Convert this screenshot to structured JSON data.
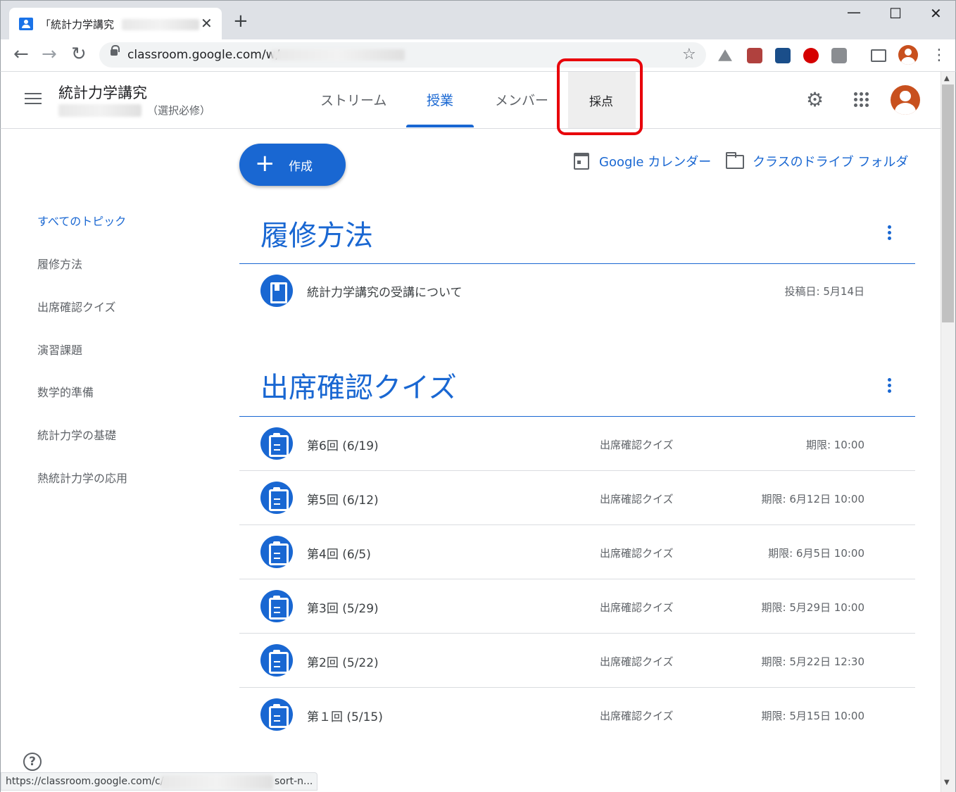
{
  "browser": {
    "tab_title": "「統計力学講究",
    "url": "classroom.google.com/w/",
    "status_url": "https://classroom.google.com/c/",
    "status_tail": "sort-n..."
  },
  "header": {
    "class_name": "統計力学講究",
    "class_section": "（選択必修）",
    "tabs": [
      {
        "label": "ストリーム"
      },
      {
        "label": "授業"
      },
      {
        "label": "メンバー"
      },
      {
        "label": "採点"
      }
    ]
  },
  "sidebar": {
    "topics": [
      {
        "label": "すべてのトピック"
      },
      {
        "label": "履修方法"
      },
      {
        "label": "出席確認クイズ"
      },
      {
        "label": "演習課題"
      },
      {
        "label": "数学的準備"
      },
      {
        "label": "統計力学の基礎"
      },
      {
        "label": "熱統計力学の応用"
      }
    ]
  },
  "main": {
    "create_label": "作成",
    "calendar_link": "Google カレンダー",
    "drive_link": "クラスのドライブ フォルダ",
    "sections": [
      {
        "title": "履修方法",
        "items": [
          {
            "title": "統計力学講究の受講について",
            "topic": "",
            "meta": "投稿日: 5月14日"
          }
        ]
      },
      {
        "title": "出席確認クイズ",
        "items": [
          {
            "title": "第6回 (6/19)",
            "topic": "出席確認クイズ",
            "meta": "期限: 10:00"
          },
          {
            "title": "第5回 (6/12)",
            "topic": "出席確認クイズ",
            "meta": "期限: 6月12日 10:00"
          },
          {
            "title": "第4回 (6/5)",
            "topic": "出席確認クイズ",
            "meta": "期限: 6月5日 10:00"
          },
          {
            "title": "第3回 (5/29)",
            "topic": "出席確認クイズ",
            "meta": "期限: 5月29日 10:00"
          },
          {
            "title": "第2回 (5/22)",
            "topic": "出席確認クイズ",
            "meta": "期限: 5月22日 12:30"
          },
          {
            "title": "第１回 (5/15)",
            "topic": "出席確認クイズ",
            "meta": "期限: 5月15日 10:00"
          }
        ]
      }
    ]
  },
  "colors": {
    "accent": "#1967d2",
    "highlight_box": "#e8000a",
    "avatar": "#c8501e"
  }
}
